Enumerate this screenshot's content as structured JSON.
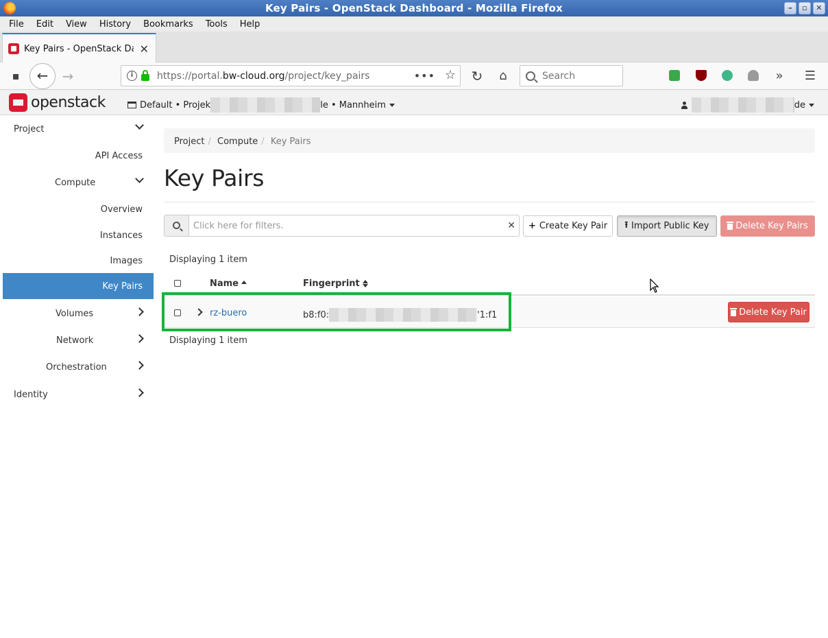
{
  "window": {
    "title": "Key Pairs - OpenStack Dashboard - Mozilla Firefox"
  },
  "menubar": [
    "File",
    "Edit",
    "View",
    "History",
    "Bookmarks",
    "Tools",
    "Help"
  ],
  "browser": {
    "tab_title": "Key Pairs - OpenStack Dashboard",
    "url_prefix": "https://portal.",
    "url_domain": "bw-cloud.org",
    "url_path": "/project/key_pairs",
    "search_placeholder": "Search"
  },
  "header": {
    "logo_text": "openstack",
    "context_prefix": "Default • Projek",
    "context_suffix": "le • Mannheim",
    "user_suffix": "de"
  },
  "sidebar": {
    "items": [
      {
        "label": "Project",
        "chevron": "down"
      },
      {
        "label": "API Access",
        "chevron": ""
      },
      {
        "label": "Compute",
        "chevron": "down"
      },
      {
        "label": "Overview",
        "chevron": ""
      },
      {
        "label": "Instances",
        "chevron": ""
      },
      {
        "label": "Images",
        "chevron": ""
      },
      {
        "label": "Key Pairs",
        "chevron": "",
        "active": true
      },
      {
        "label": "Volumes",
        "chevron": "right"
      },
      {
        "label": "Network",
        "chevron": "right"
      },
      {
        "label": "Orchestration",
        "chevron": "right"
      },
      {
        "label": "Identity",
        "chevron": "right"
      }
    ]
  },
  "breadcrumb": [
    "Project",
    "Compute",
    "Key Pairs"
  ],
  "page": {
    "title": "Key Pairs"
  },
  "toolbar": {
    "filter_placeholder": "Click here for filters.",
    "create_label": "Create Key Pair",
    "import_label": "Import Public Key",
    "delete_all_label": "Delete Key Pairs"
  },
  "table": {
    "count_text": "Displaying 1 item",
    "columns": [
      "Name",
      "Fingerprint"
    ],
    "rows": [
      {
        "name": "rz-buero",
        "fingerprint_prefix": "b8:f0:",
        "fingerprint_suffix": "'1:f1",
        "action_label": "Delete Key Pair"
      }
    ]
  },
  "colors": {
    "accent": "#3f87c7",
    "danger": "#d9534f",
    "highlight": "#18b33a",
    "brand": "#da1a32"
  }
}
